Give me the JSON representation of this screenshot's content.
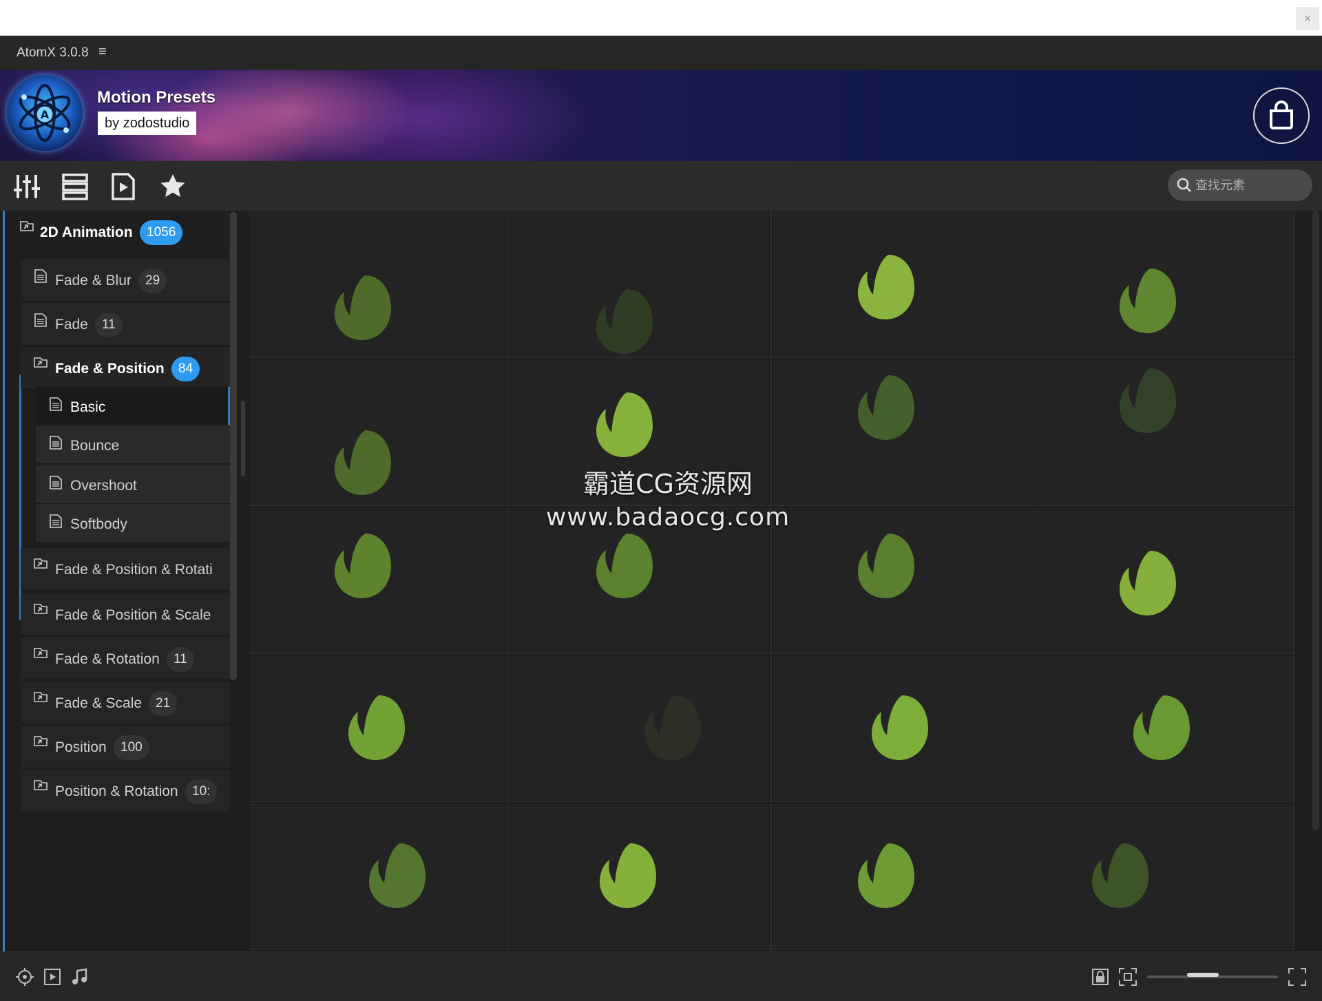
{
  "app": {
    "title": "AtomX 3.0.8",
    "menu_icon": "hamburger-icon"
  },
  "banner": {
    "title": "Motion Presets",
    "by": "by",
    "author": "zodostudio"
  },
  "toolbar": {
    "tools": [
      "sliders-icon",
      "list-icon",
      "media-file-icon",
      "star-icon"
    ],
    "search_placeholder": "查找元素"
  },
  "sidebar": {
    "items": [
      {
        "label": "2D Animation",
        "count": "1056",
        "level": 0,
        "type": "folder",
        "active": true
      },
      {
        "label": "Fade & Blur",
        "count": "29",
        "level": 1,
        "type": "file"
      },
      {
        "label": "Fade",
        "count": "11",
        "level": 1,
        "type": "file"
      },
      {
        "label": "Fade & Position",
        "count": "84",
        "level": 1,
        "type": "folder",
        "active": true
      },
      {
        "label": "Basic",
        "count": "",
        "level": 2,
        "type": "file",
        "selected": true
      },
      {
        "label": "Bounce",
        "count": "",
        "level": 2,
        "type": "file"
      },
      {
        "label": "Overshoot",
        "count": "",
        "level": 2,
        "type": "file"
      },
      {
        "label": "Softbody",
        "count": "",
        "level": 2,
        "type": "file"
      },
      {
        "label": "Fade & Position & Rotati",
        "count": "",
        "level": 1,
        "type": "folder"
      },
      {
        "label": "Fade & Position & Scale",
        "count": "",
        "level": 1,
        "type": "folder"
      },
      {
        "label": "Fade & Rotation",
        "count": "11",
        "level": 1,
        "type": "folder"
      },
      {
        "label": "Fade & Scale",
        "count": "21",
        "level": 1,
        "type": "folder"
      },
      {
        "label": "Position",
        "count": "100",
        "level": 1,
        "type": "folder"
      },
      {
        "label": "Position & Rotation",
        "count": "10:",
        "level": 1,
        "type": "folder"
      }
    ]
  },
  "watermark": {
    "line1": "霸道CG资源网",
    "line2": "www.badaocg.com"
  },
  "statusbar": {
    "left_icons": [
      "target-icon",
      "video-icon",
      "music-note-icon"
    ],
    "right_icons": [
      "lock-icon",
      "fit-view-icon",
      "expand-icon"
    ]
  }
}
